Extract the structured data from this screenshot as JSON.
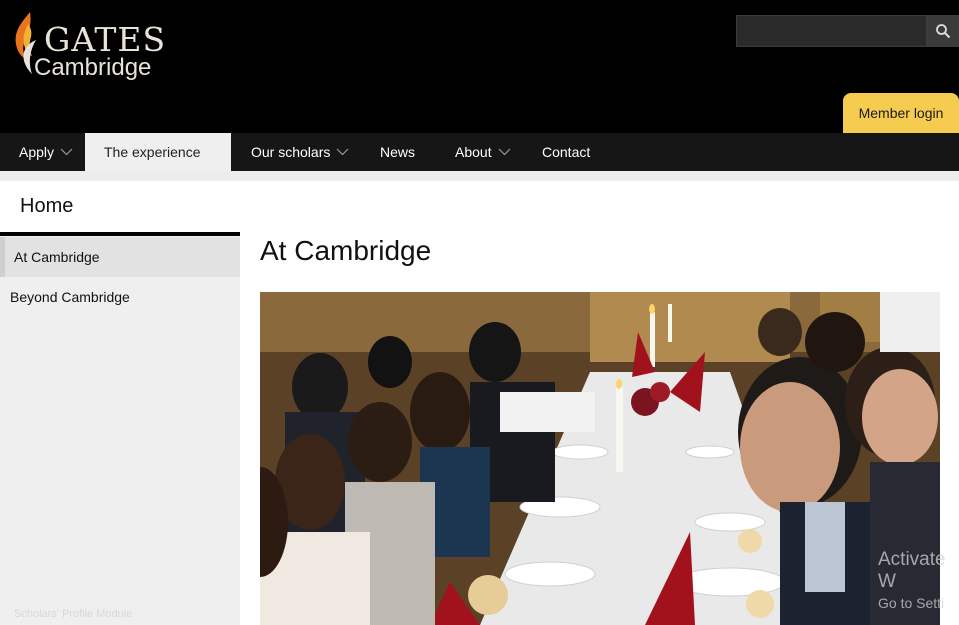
{
  "header": {
    "logo": {
      "line1": "GATES",
      "line2": "Cambridge"
    },
    "search": {
      "value": "",
      "placeholder": ""
    },
    "member_login_label": "Member login",
    "colors": {
      "background": "#000000",
      "member_login": "#f6cc50"
    }
  },
  "nav": {
    "items": [
      {
        "label": "Apply",
        "has_dropdown": true,
        "active": false
      },
      {
        "label": "The experience",
        "has_dropdown": false,
        "active": true
      },
      {
        "label": "Our scholars",
        "has_dropdown": true,
        "active": false
      },
      {
        "label": "News",
        "has_dropdown": false,
        "active": false
      },
      {
        "label": "About",
        "has_dropdown": true,
        "active": false
      },
      {
        "label": "Contact",
        "has_dropdown": false,
        "active": false
      }
    ]
  },
  "sidebar": {
    "title": "Home",
    "items": [
      {
        "label": "At Cambridge",
        "active": true
      },
      {
        "label": "Beyond Cambridge",
        "active": false
      }
    ],
    "faint_text": "Scholars' Profile Module"
  },
  "main": {
    "title": "At Cambridge",
    "image_icon": "formal-dinner-photo"
  },
  "watermark": {
    "line1": "Activate W",
    "line2": "Go to Setti"
  }
}
